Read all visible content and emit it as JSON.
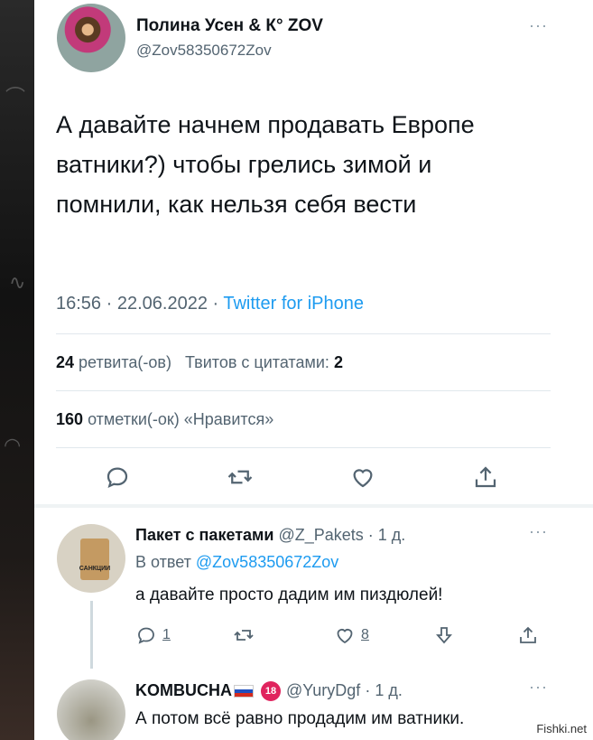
{
  "tweet": {
    "author_name": "Полина Усен & К° ZOV",
    "author_handle": "@Zov58350672Zov",
    "text": "А давайте начнем продавать Европе ватники?) чтобы грелись зимой и помнили, как нельзя себя вести",
    "time": "16:56",
    "date": "22.06.2022",
    "source": "Twitter for iPhone",
    "retweets_count": "24",
    "retweets_label": "ретвита(-ов)",
    "quotes_label": "Твитов с цитатами:",
    "quotes_count": "2",
    "likes_count": "160",
    "likes_label": "отметки(-ок) «Нравится»",
    "more": "···"
  },
  "replies": [
    {
      "name": "Пакет с пакетами",
      "handle": "@Z_Pakets",
      "time": "· 1 д.",
      "reply_to_label": "В ответ",
      "reply_to_handle": "@Zov58350672Zov",
      "text": "а давайте просто дадим им пиздюлей!",
      "reply_count": "1",
      "like_count": "8",
      "more": "···",
      "avatar_caption": "САНКЦИИ"
    },
    {
      "name": "KOMBUCHA",
      "badge_18": "18",
      "handle": "@YuryDgf",
      "time": "· 1 д.",
      "text": "А потом всё равно продадим им ватники.",
      "more": "···"
    }
  ],
  "watermark": "Fishki.net",
  "colors": {
    "accent": "#1d9bf0",
    "text": "#0f1419",
    "secondary": "#536471"
  }
}
